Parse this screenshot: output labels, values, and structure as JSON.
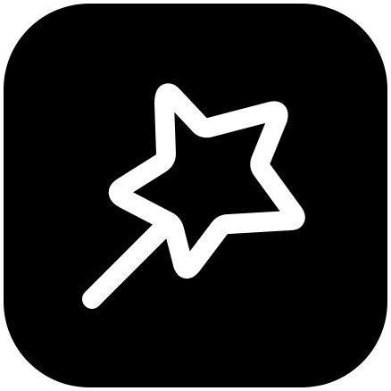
{
  "icon": {
    "name": "magic-wand-icon",
    "background_color": "#000000",
    "glyph_color": "#ffffff"
  }
}
